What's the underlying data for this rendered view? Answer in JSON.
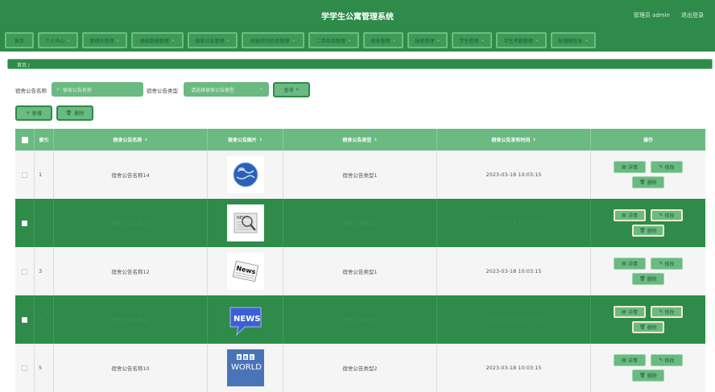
{
  "header": {
    "title": "学学生公寓管理系统",
    "user": "管理员 admin",
    "logout": "退出登录"
  },
  "nav": {
    "items": [
      {
        "label": "首页",
        "dropdown": false
      },
      {
        "label": "个人中心",
        "dropdown": true
      },
      {
        "label": "管理员管理",
        "dropdown": true
      },
      {
        "label": "基础数据管理",
        "dropdown": true
      },
      {
        "label": "宿舍公告管理",
        "dropdown": true
      },
      {
        "label": "校园资讯信息管理",
        "dropdown": true
      },
      {
        "label": "二手商品管理",
        "dropdown": true
      },
      {
        "label": "宿舍管理",
        "dropdown": true
      },
      {
        "label": "报修管理",
        "dropdown": true
      },
      {
        "label": "学生管理",
        "dropdown": true
      },
      {
        "label": "学生考勤管理",
        "dropdown": true
      },
      {
        "label": "轮播图信息",
        "dropdown": true
      }
    ]
  },
  "breadcrumb": {
    "text": "首页 /"
  },
  "search": {
    "name_label": "宿舍公告名称",
    "name_placeholder": "宿舍公告名称",
    "type_label": "宿舍公告类型",
    "type_placeholder": "请选择宿舍公告类型",
    "query_button": "查询"
  },
  "actions": {
    "add": "新增",
    "delete": "删除"
  },
  "table": {
    "headers": {
      "index": "索引",
      "name": "宿舍公告名称",
      "image": "宿舍公告图片",
      "type": "宿舍公告类型",
      "time": "宿舍公告发布时间",
      "ops": "操作"
    },
    "op_labels": {
      "detail": "详情",
      "edit": "修改",
      "delete": "删除"
    },
    "rows": [
      {
        "index": "1",
        "name": "宿舍公告名称14",
        "image": "globe-image",
        "type": "宿舍公告类型1",
        "time": "2023-03-18 10:03:15"
      },
      {
        "index": "2",
        "name": "宿舍公告名称13",
        "image": "newspaper-magnifier-image",
        "type": "宿舍公告类型2",
        "time": "2023-03-18 10:03:15"
      },
      {
        "index": "3",
        "name": "宿舍公告名称12",
        "image": "news-paper-image",
        "type": "宿舍公告类型1",
        "time": "2023-03-18 10:03:15"
      },
      {
        "index": "4",
        "name": "宿舍公告名称11",
        "image": "news-bubble-image",
        "type": "宿舍公告类型2",
        "time": "2023-03-18 10:03:15"
      },
      {
        "index": "5",
        "name": "宿舍公告名称10",
        "image": "bbc-world-image",
        "type": "宿舍公告类型2",
        "time": "2023-03-18 10:03:15"
      }
    ]
  },
  "colors": {
    "primary": "#2e8b4a",
    "accent": "#6aba82",
    "stripe": "#f5f5f5"
  }
}
